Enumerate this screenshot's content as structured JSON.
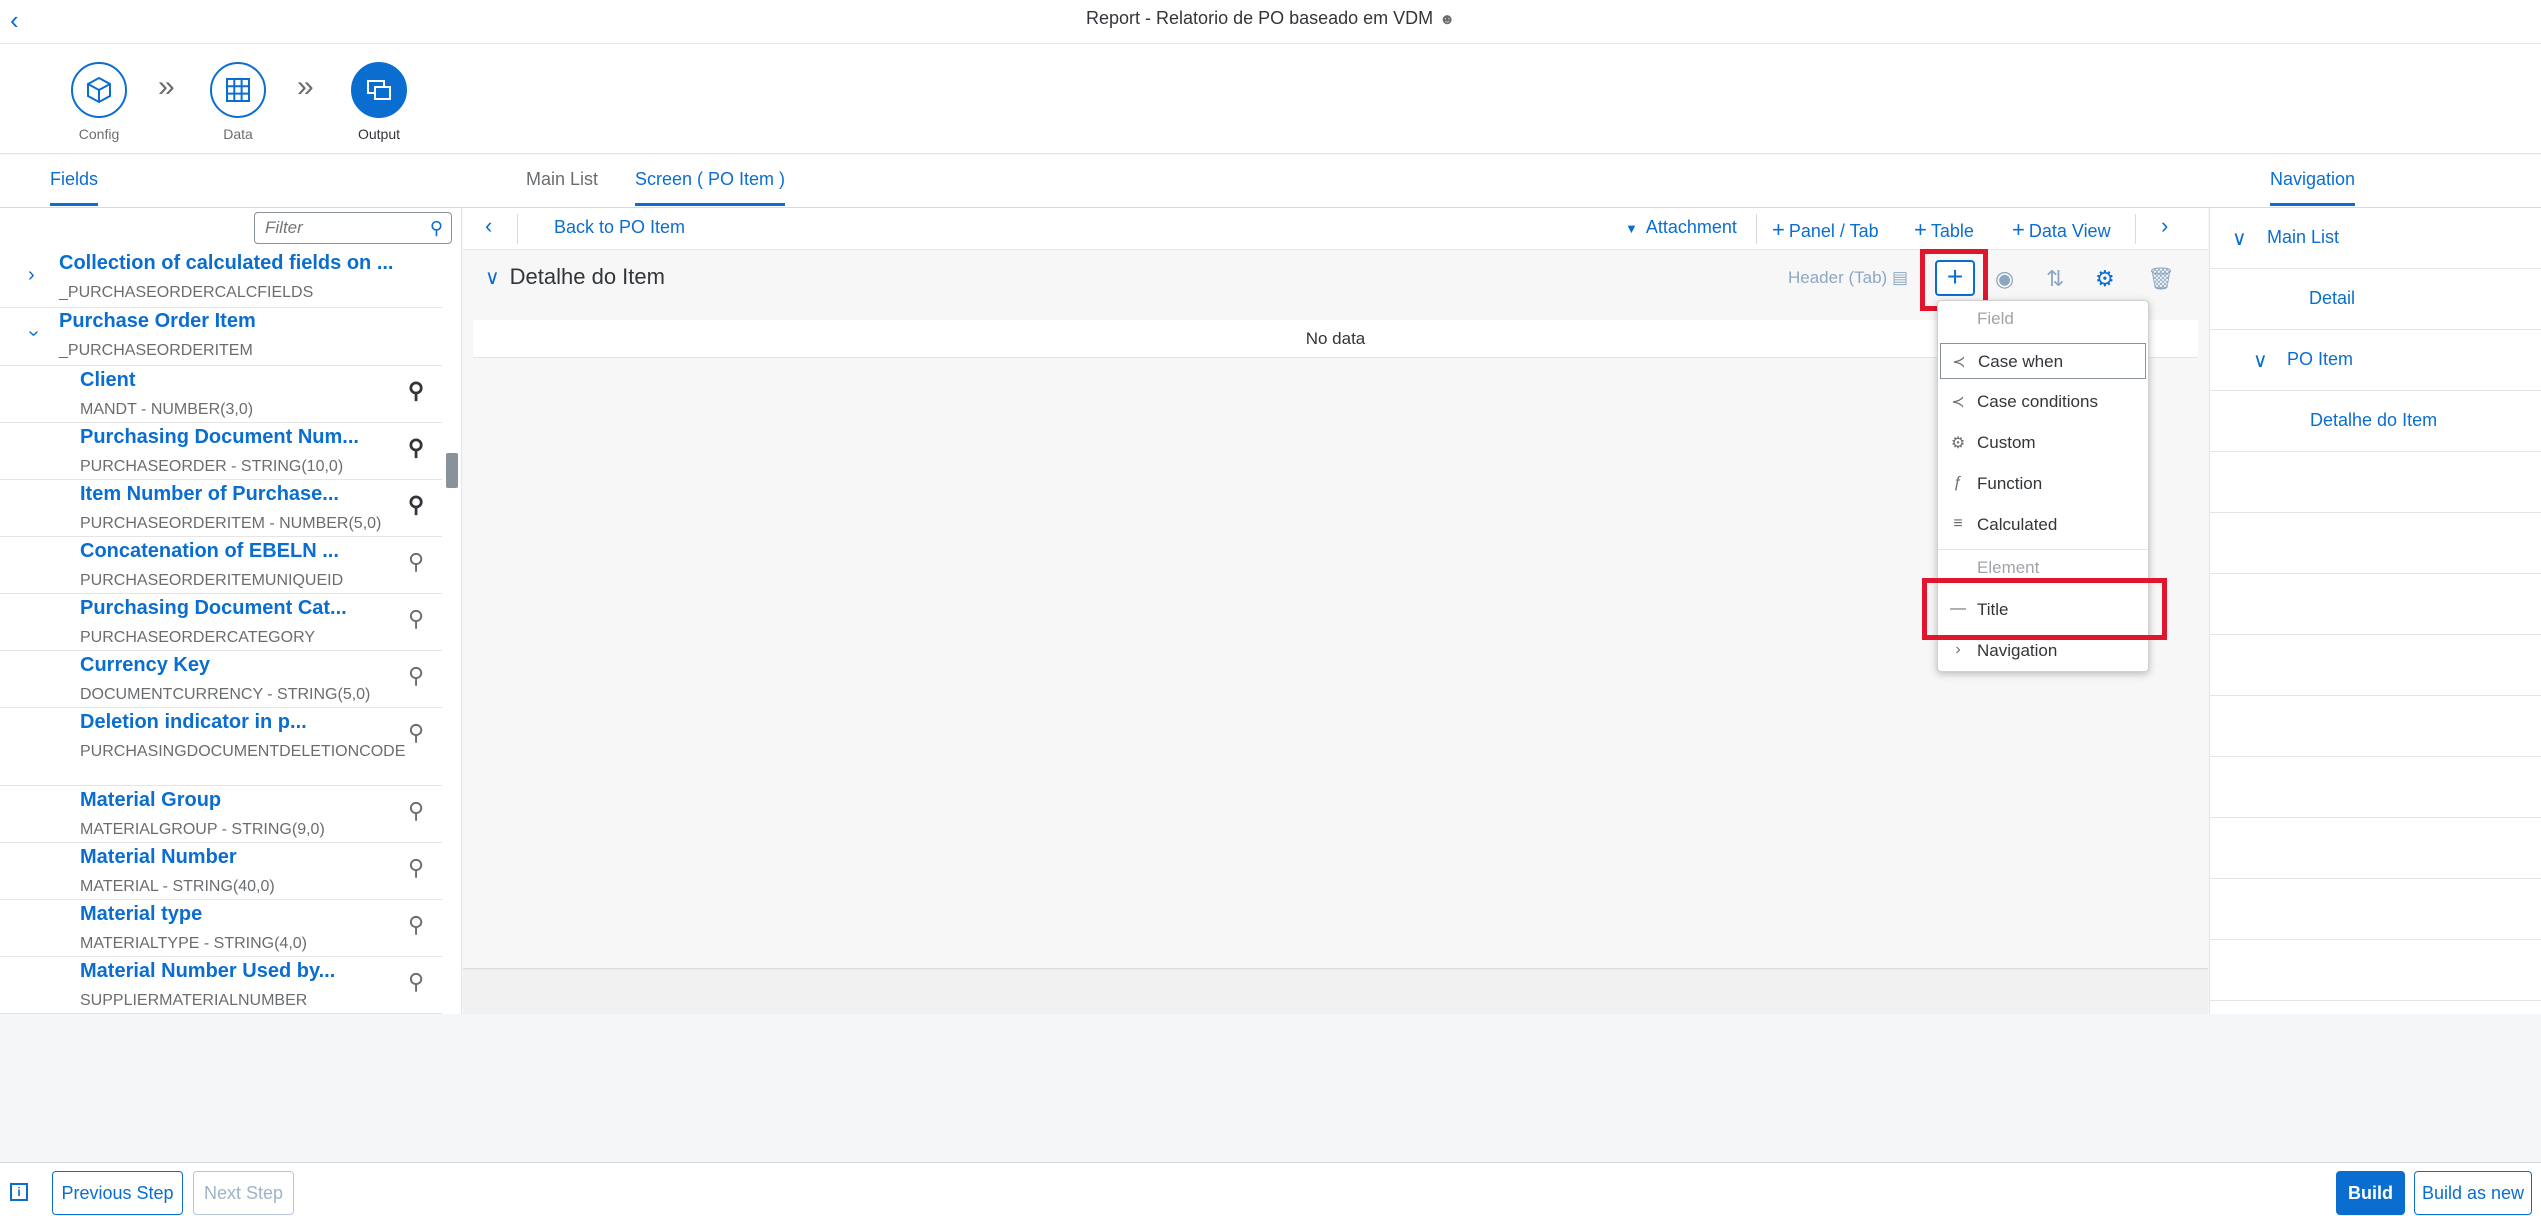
{
  "app": {
    "title": "Report - Relatorio de PO baseado em VDM"
  },
  "wizard": {
    "steps": [
      {
        "label": "Config"
      },
      {
        "label": "Data"
      },
      {
        "label": "Output"
      }
    ]
  },
  "tabs": {
    "left": "Fields",
    "center": [
      "Main List",
      "Screen ( PO Item )"
    ],
    "right": "Navigation"
  },
  "left": {
    "filter_placeholder": "Filter",
    "groups": [
      {
        "name": "Collection of calculated fields on ...",
        "tech": "_PURCHASEORDERCALCFIELDS"
      },
      {
        "name": "Purchase Order Item",
        "tech": "_PURCHASEORDERITEM"
      }
    ],
    "fields": [
      {
        "name": "Client",
        "tech": "MANDT - NUMBER(3,0)"
      },
      {
        "name": "Purchasing Document Num...",
        "tech": "PURCHASEORDER - STRING(10,0)"
      },
      {
        "name": "Item Number of Purchase...",
        "tech": "PURCHASEORDERITEM - NUMBER(5,0)"
      },
      {
        "name": "Concatenation of EBELN ...",
        "tech": "PURCHASEORDERITEMUNIQUEID"
      },
      {
        "name": "Purchasing Document Cat...",
        "tech": "PURCHASEORDERCATEGORY"
      },
      {
        "name": "Currency Key",
        "tech": "DOCUMENTCURRENCY - STRING(5,0)"
      },
      {
        "name": "Deletion indicator in p...",
        "tech": "PURCHASINGDOCUMENTDELETIONCODE"
      },
      {
        "name": "Material Group",
        "tech": "MATERIALGROUP - STRING(9,0)"
      },
      {
        "name": "Material Number",
        "tech": "MATERIAL - STRING(40,0)"
      },
      {
        "name": "Material type",
        "tech": "MATERIALTYPE - STRING(4,0)"
      },
      {
        "name": "Material Number Used by...",
        "tech": "SUPPLIERMATERIALNUMBER"
      }
    ]
  },
  "toolbar": {
    "back_label": "Back to PO Item",
    "attachment": "Attachment",
    "panel_tab": "Panel / Tab",
    "table": "Table",
    "data_view": "Data View"
  },
  "section": {
    "title": "Detalhe do Item",
    "header_tab": "Header (Tab)",
    "no_data": "No data"
  },
  "menu": {
    "field_header": "Field",
    "field_items": [
      "Case when",
      "Case conditions",
      "Custom",
      "Function",
      "Calculated"
    ],
    "element_header": "Element",
    "element_items": [
      "Title",
      "Navigation"
    ]
  },
  "right": {
    "nav_items": [
      {
        "label": "Main List"
      },
      {
        "label": "Detail"
      },
      {
        "label": "PO Item"
      },
      {
        "label": "Detalhe do Item"
      }
    ]
  },
  "footer": {
    "info": "i",
    "previous": "Previous Step",
    "next": "Next Step",
    "build": "Build",
    "build_new": "Build as new"
  },
  "colors": {
    "accent": "#0a6ed1",
    "highlight": "#e0172c"
  }
}
